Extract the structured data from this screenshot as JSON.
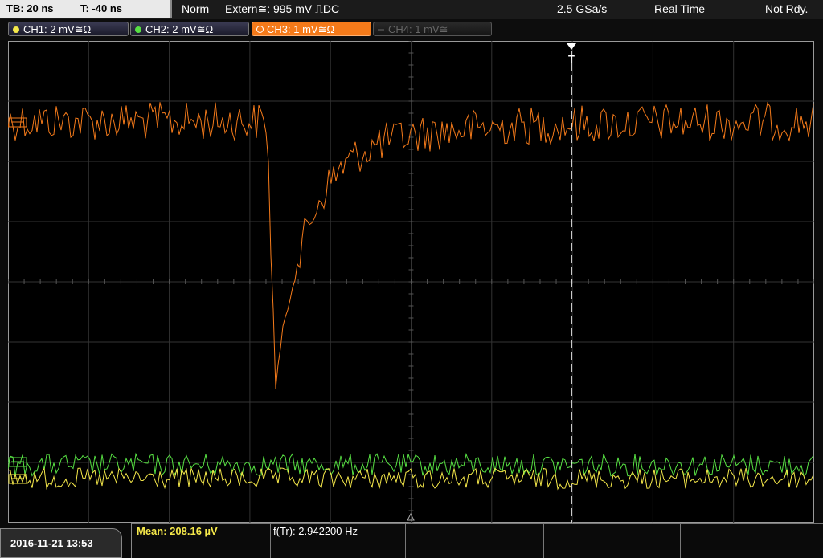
{
  "topbar": {
    "timebase": "TB: 20 ns",
    "trigger_time": "T: -40 ns",
    "mode": "Norm",
    "trigger_source": "Extern≅: 995 mV ⎍DC",
    "sample_rate": "2.5 GSa/s",
    "acquisition": "Real Time",
    "status": "Not Rdy."
  },
  "channels": [
    {
      "label": "CH1: 2 mV≅Ω",
      "color": "#f5e84a",
      "state": "on"
    },
    {
      "label": "CH2: 2 mV≅Ω",
      "color": "#57e043",
      "state": "on"
    },
    {
      "label": "CH3: 1 mV≅Ω",
      "color": "#f47a1a",
      "state": "active"
    },
    {
      "label": "CH4: 1 mV≅",
      "color": "#5a5a5a",
      "state": "off"
    }
  ],
  "trigger_marker": "T",
  "measurements": {
    "mean": "Mean: 208.16 µV",
    "frequency": "f(Tr): 2.942200 Hz"
  },
  "datetime": "2016-11-21 13:53",
  "colors": {
    "ch1": "#f5e84a",
    "ch2": "#57e043",
    "ch3": "#f47a1a",
    "grid": "#3a3a3a"
  }
}
